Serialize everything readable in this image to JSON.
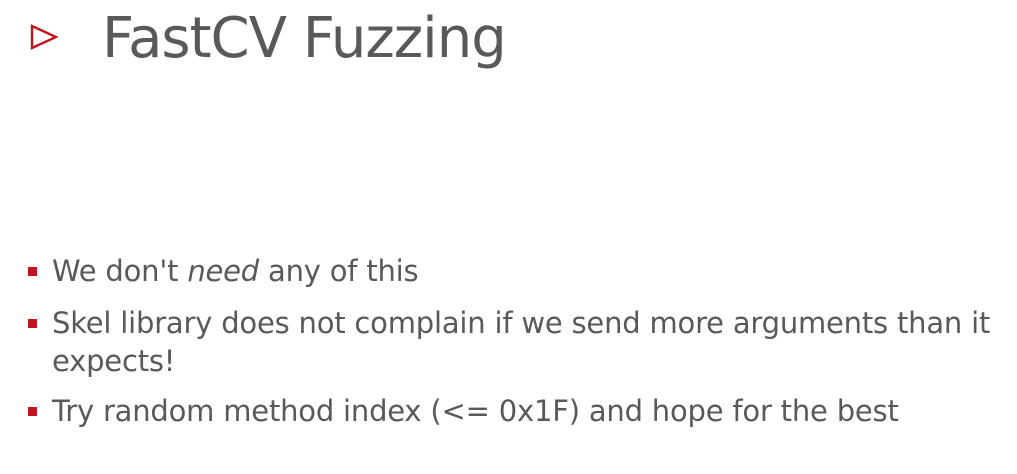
{
  "slide": {
    "title": "FastCV Fuzzing",
    "accent_color": "#c0121f",
    "text_color": "#595959",
    "title_marker_icon": "triangle-right-outline-icon"
  },
  "bullets": [
    {
      "before": "We don't ",
      "emphasis": "need",
      "after": " any of this"
    },
    {
      "text": "Skel library does not complain if we send more arguments than it expects!"
    },
    {
      "text": "Try random method index (<= 0x1F) and hope for the best"
    }
  ]
}
